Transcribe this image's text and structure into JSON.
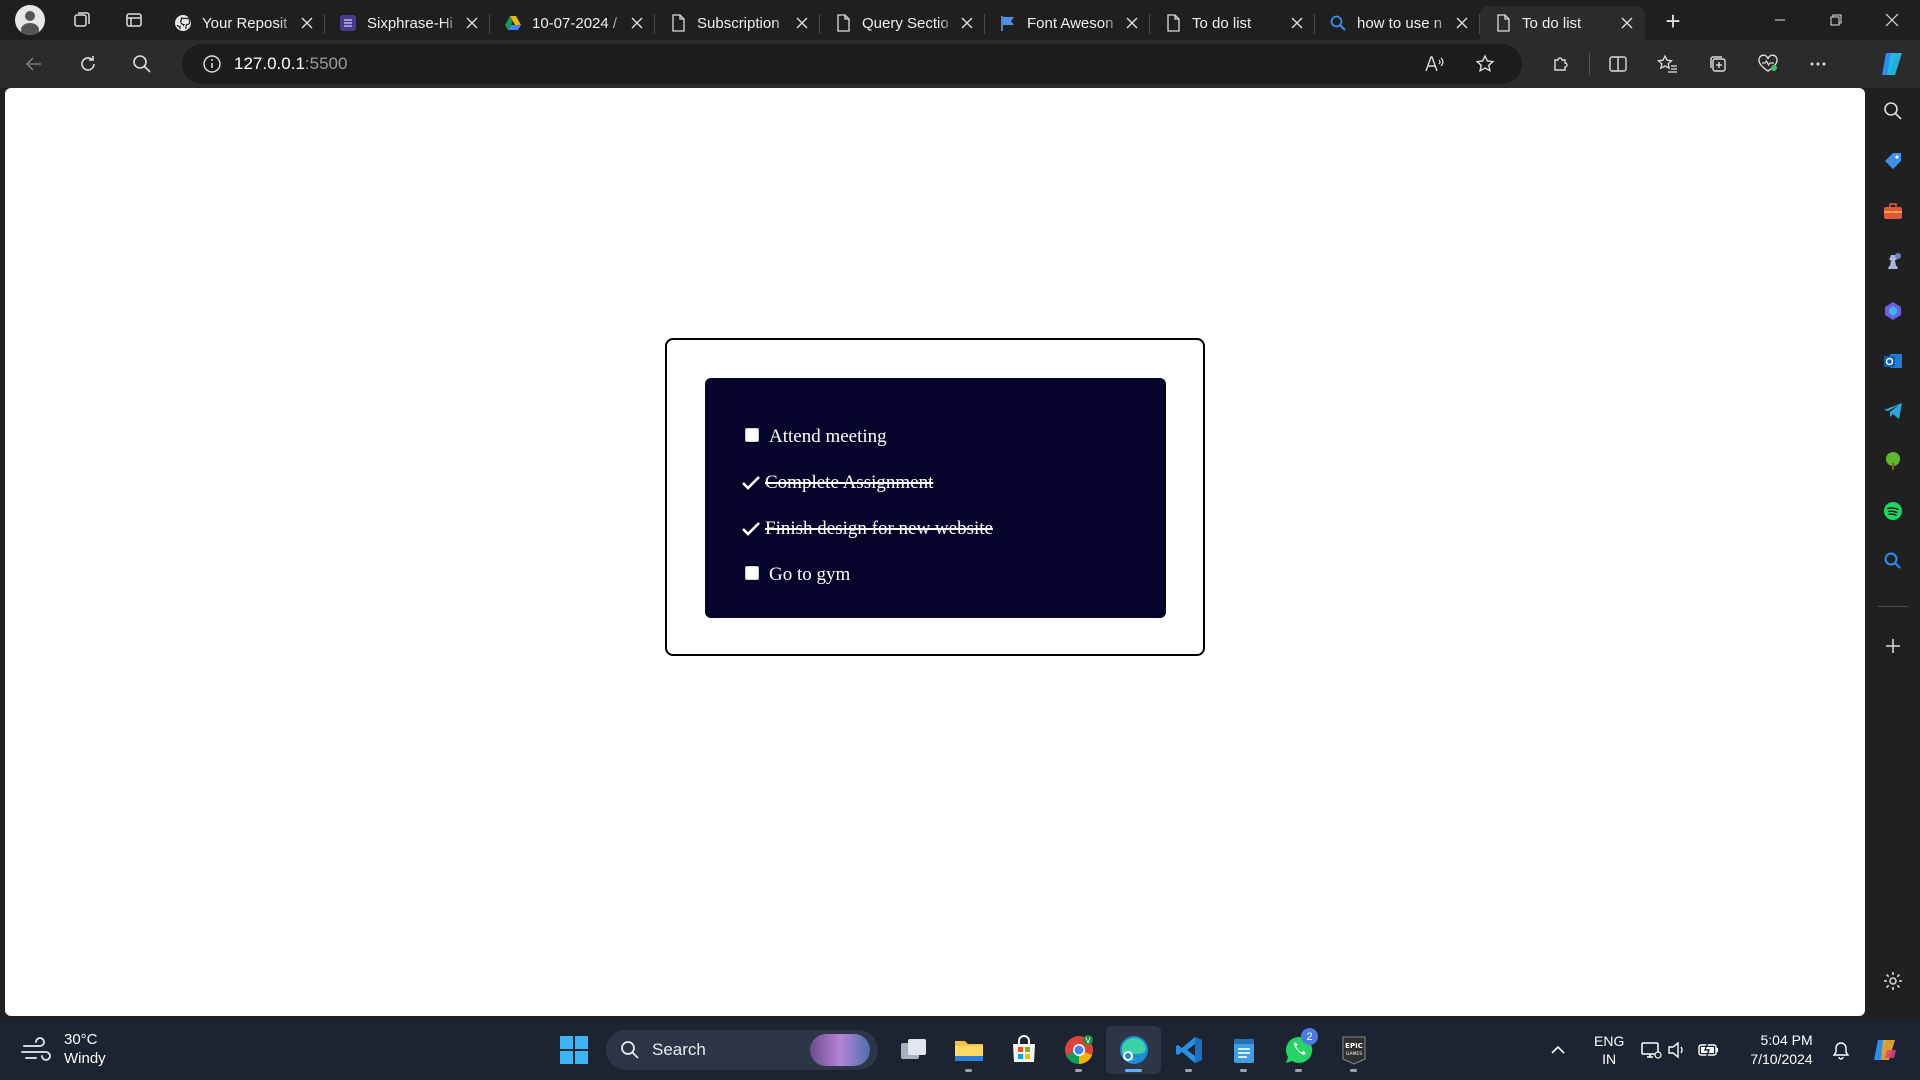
{
  "browser": {
    "tabs": [
      {
        "title": "Your Reposit",
        "icon": "github-icon",
        "active": false
      },
      {
        "title": "Sixphrase-Hi",
        "icon": "list-icon",
        "active": false
      },
      {
        "title": "10-07-2024 /",
        "icon": "drive-icon",
        "active": false
      },
      {
        "title": "Subscription",
        "icon": "page-icon",
        "active": false
      },
      {
        "title": "Query Sectio",
        "icon": "page-icon",
        "active": false
      },
      {
        "title": "Font Aweson",
        "icon": "flag-icon",
        "active": false
      },
      {
        "title": "To do list",
        "icon": "page-icon",
        "active": false
      },
      {
        "title": "how to use n",
        "icon": "search-icon",
        "active": false
      },
      {
        "title": "To do list",
        "icon": "page-icon",
        "active": true
      }
    ],
    "address": {
      "host": "127.0.0.1",
      "port": ":5500"
    },
    "window_controls": [
      "minimize",
      "restore",
      "close"
    ]
  },
  "page": {
    "todos": [
      {
        "text": "Attend meeting",
        "done": false
      },
      {
        "text": "Complete Assignment",
        "done": true
      },
      {
        "text": "Finish design for new website",
        "done": true
      },
      {
        "text": "Go to gym",
        "done": false
      }
    ],
    "colors": {
      "todo_background": "#05052c",
      "card_border": "#000000",
      "text": "#ffffff"
    }
  },
  "sidebar": {
    "items": [
      "search-icon",
      "tag-icon",
      "toolbox-icon",
      "chess-icon",
      "copilot-app-icon",
      "outlook-icon",
      "telegram-icon",
      "tree-icon",
      "spotify-icon",
      "bing-search-icon",
      "add-icon",
      "settings-icon"
    ]
  },
  "taskbar": {
    "weather": {
      "temp": "30°C",
      "condition": "Windy"
    },
    "search_label": "Search",
    "apps": [
      "task-view",
      "file-explorer",
      "microsoft-store",
      "chrome",
      "edge",
      "vscode",
      "notepad",
      "whatsapp",
      "epic-games"
    ],
    "whatsapp_badge": "2",
    "language": {
      "line1": "ENG",
      "line2": "IN"
    },
    "clock": {
      "time": "5:04 PM",
      "date": "7/10/2024"
    }
  }
}
